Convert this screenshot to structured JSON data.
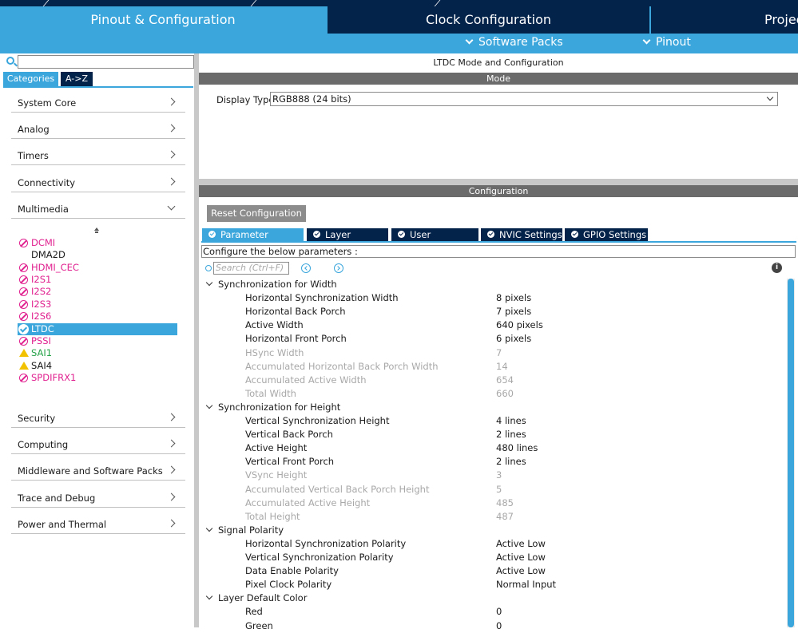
{
  "tabs": {
    "pinout": "Pinout & Configuration",
    "clock": "Clock Configuration",
    "project": "Projec"
  },
  "subbar": {
    "software_packs": "Software Packs",
    "pinout": "Pinout"
  },
  "sidebar": {
    "search_value": "",
    "tabs": [
      "Categories",
      "A->Z"
    ],
    "categories": [
      "System Core",
      "Analog",
      "Timers",
      "Connectivity",
      "Multimedia"
    ],
    "peripherals": [
      {
        "label": "DCMI",
        "status": "disabled"
      },
      {
        "label": "DMA2D",
        "status": "none"
      },
      {
        "label": "HDMI_CEC",
        "status": "disabled"
      },
      {
        "label": "I2S1",
        "status": "disabled"
      },
      {
        "label": "I2S2",
        "status": "disabled"
      },
      {
        "label": "I2S3",
        "status": "disabled"
      },
      {
        "label": "I2S6",
        "status": "disabled"
      },
      {
        "label": "LTDC",
        "status": "enabled"
      },
      {
        "label": "PSSI",
        "status": "disabled"
      },
      {
        "label": "SAI1",
        "status": "warning"
      },
      {
        "label": "SAI4",
        "status": "warning"
      },
      {
        "label": "SPDIFRX1",
        "status": "disabled"
      }
    ],
    "categories_bottom": [
      "Security",
      "Computing",
      "Middleware and Software Packs",
      "Trace and Debug",
      "Power and Thermal"
    ]
  },
  "main": {
    "title": "LTDC Mode and Configuration",
    "mode_band": "Mode",
    "display_type_label": "Display Type",
    "display_type_value": "RGB888 (24 bits)",
    "config_band": "Configuration",
    "reset_button": "Reset Configuration",
    "param_tabs": [
      "Parameter Settings",
      "Layer Settings",
      "User Constants",
      "NVIC Settings",
      "GPIO Settings"
    ],
    "configure_text": "Configure the below parameters :",
    "search_placeholder": "Search (Ctrl+F)",
    "groups": [
      {
        "title": "Synchronization for Width",
        "params": [
          {
            "name": "Horizontal Synchronization Width",
            "value": "8 pixels",
            "disabled": false
          },
          {
            "name": "Horizontal Back Porch",
            "value": "7 pixels",
            "disabled": false
          },
          {
            "name": "Active Width",
            "value": "640 pixels",
            "disabled": false
          },
          {
            "name": "Horizontal Front Porch",
            "value": "6 pixels",
            "disabled": false
          },
          {
            "name": "HSync Width",
            "value": "7",
            "disabled": true
          },
          {
            "name": "Accumulated Horizontal Back Porch Width",
            "value": "14",
            "disabled": true
          },
          {
            "name": "Accumulated Active Width",
            "value": "654",
            "disabled": true
          },
          {
            "name": "Total Width",
            "value": "660",
            "disabled": true
          }
        ]
      },
      {
        "title": "Synchronization for Height",
        "params": [
          {
            "name": "Vertical Synchronization Height",
            "value": "4 lines",
            "disabled": false
          },
          {
            "name": "Vertical Back Porch",
            "value": "2 lines",
            "disabled": false
          },
          {
            "name": "Active Height",
            "value": "480 lines",
            "disabled": false
          },
          {
            "name": "Vertical Front Porch",
            "value": "2 lines",
            "disabled": false
          },
          {
            "name": "VSync Height",
            "value": "3",
            "disabled": true
          },
          {
            "name": "Accumulated Vertical Back Porch Height",
            "value": "5",
            "disabled": true
          },
          {
            "name": "Accumulated Active Height",
            "value": "485",
            "disabled": true
          },
          {
            "name": "Total Height",
            "value": "487",
            "disabled": true
          }
        ]
      },
      {
        "title": "Signal Polarity",
        "params": [
          {
            "name": "Horizontal Synchronization Polarity",
            "value": "Active Low",
            "disabled": false
          },
          {
            "name": "Vertical Synchronization Polarity",
            "value": "Active Low",
            "disabled": false
          },
          {
            "name": "Data Enable Polarity",
            "value": "Active Low",
            "disabled": false
          },
          {
            "name": "Pixel Clock Polarity",
            "value": "Normal Input",
            "disabled": false
          }
        ]
      },
      {
        "title": "Layer Default Color",
        "params": [
          {
            "name": "Red",
            "value": "0",
            "disabled": false
          },
          {
            "name": "Green",
            "value": "0",
            "disabled": false
          }
        ]
      }
    ]
  },
  "colors": {
    "accent": "#3aa6dc",
    "navy": "#03234b",
    "disabled_icon": "#e0208f",
    "warning": "#f2c200",
    "band": "#6b6b6b"
  }
}
